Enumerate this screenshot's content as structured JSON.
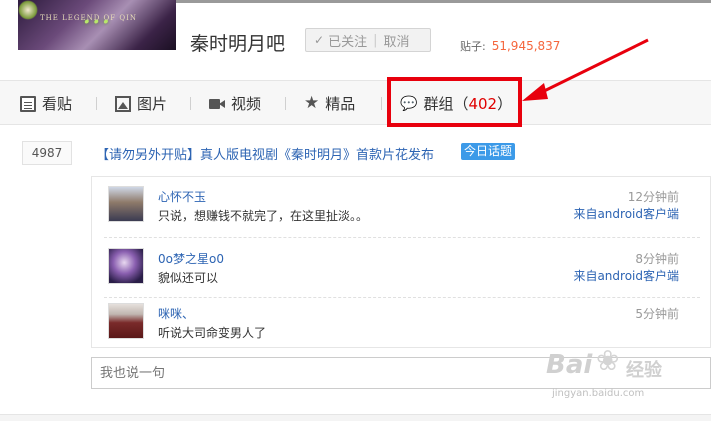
{
  "header": {
    "banner_logo_text": "...",
    "banner_logo_sub": "THE LEGEND OF QIN",
    "forum_name": "秦时明月吧",
    "followed_label": "已关注",
    "cancel_label": "取消",
    "posts_label": "贴子:",
    "posts_count": "51,945,837"
  },
  "nav": {
    "items": [
      {
        "label": "看贴",
        "icon": "document-icon"
      },
      {
        "label": "图片",
        "icon": "image-icon"
      },
      {
        "label": "视频",
        "icon": "video-icon"
      },
      {
        "label": "精品",
        "icon": "star-icon"
      },
      {
        "label": "群组（",
        "icon": "chat-icon",
        "count": "402",
        "suffix": "）"
      }
    ]
  },
  "thread": {
    "reply_count": "4987",
    "title": "【请勿另外开贴】真人版电视剧《秦时明月》首款片花发布",
    "tag": "今日话题"
  },
  "comments": [
    {
      "user": "心怀不玉",
      "text": "只说，想赚钱不就完了，在这里扯淡。。",
      "time": "12分钟前",
      "source": "来自android客户端"
    },
    {
      "user": "0o梦之星o0",
      "text": "貌似还可以",
      "time": "8分钟前",
      "source": "来自android客户端"
    },
    {
      "user": "咪咪、",
      "text": "听说大司命变男人了",
      "time": "5分钟前",
      "source": ""
    }
  ],
  "reply_input": {
    "placeholder": "我也说一句"
  },
  "watermark": {
    "logo": "Bai",
    "logo_tail": "经验",
    "url": "jingyan.baidu.com"
  },
  "colors": {
    "highlight": "#e8000d",
    "link_blue": "#2d64b3",
    "post_count_orange": "#f5663c",
    "tag_blue": "#3c9ae8",
    "group_count_red": "#e00000"
  }
}
